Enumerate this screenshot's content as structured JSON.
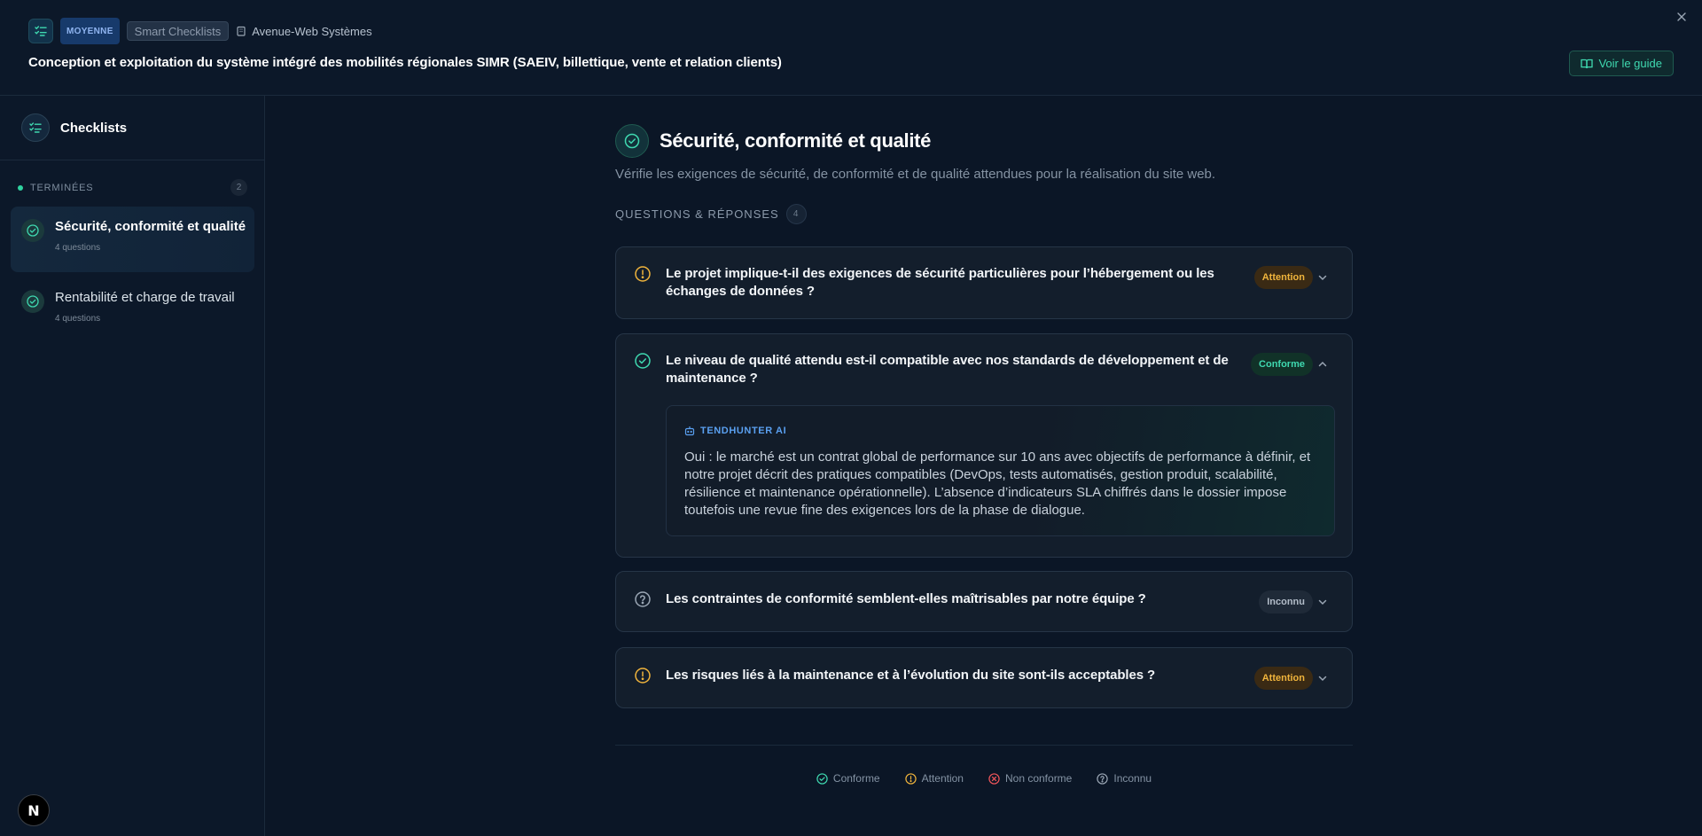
{
  "header": {
    "level_badge": "MOYENNE",
    "app_name": "Smart Checklists",
    "company": "Avenue-Web Systèmes",
    "title": "Conception et exploitation du système intégré des mobilités régionales SIMR (SAEIV, billettique, vente et relation clients)",
    "guide_button": "Voir le guide"
  },
  "sidebar": {
    "title": "Checklists",
    "section_label": "TERMINÉES",
    "section_count": "2",
    "items": [
      {
        "title": "Sécurité, conformité et qualité",
        "subtitle": "4 questions",
        "active": true
      },
      {
        "title": "Rentabilité et charge de travail",
        "subtitle": "4 questions",
        "active": false
      }
    ],
    "avatar_letter": "N"
  },
  "main": {
    "title": "Sécurité, conformité et qualité",
    "description": "Vérifie les exigences de sécurité, de conformité et de qualité attendues pour la réalisation du site web.",
    "qa_label": "QUESTIONS & RÉPONSES",
    "qa_count": "4",
    "questions": [
      {
        "text": "Le projet implique-t-il des exigences de sécurité particulières pour l’hébergement ou les échanges de données ?",
        "status": "Attention",
        "status_type": "attention",
        "expanded": false
      },
      {
        "text": "Le niveau de qualité attendu est-il compatible avec nos standards de développement et de maintenance ?",
        "status": "Conforme",
        "status_type": "conforme",
        "expanded": true,
        "ai_label": "TENDHUNTER AI",
        "ai_answer": "Oui : le marché est un contrat global de performance sur 10 ans avec objectifs de performance à définir, et notre projet décrit des pratiques compatibles (DevOps, tests automatisés, gestion produit, scalabilité, résilience et maintenance opérationnelle). L’absence d’indicateurs SLA chiffrés dans le dossier impose toutefois une revue fine des exigences lors de la phase de dialogue."
      },
      {
        "text": "Les contraintes de conformité semblent-elles maîtrisables par notre équipe ?",
        "status": "Inconnu",
        "status_type": "inconnu",
        "expanded": false
      },
      {
        "text": "Les risques liés à la maintenance et à l’évolution du site sont-ils acceptables ?",
        "status": "Attention",
        "status_type": "attention",
        "expanded": false
      }
    ],
    "legend": [
      {
        "label": "Conforme",
        "icon": "check-circle-icon",
        "color": "#3fd9b0"
      },
      {
        "label": "Attention",
        "icon": "alert-circle-icon",
        "color": "#f0b43c"
      },
      {
        "label": "Non conforme",
        "icon": "x-circle-icon",
        "color": "#f0555a"
      },
      {
        "label": "Inconnu",
        "icon": "help-circle-icon",
        "color": "#9aa6b4"
      }
    ]
  },
  "colors": {
    "background": "#0b1626",
    "accent": "#3fd9b0",
    "attention": "#f0b43c",
    "non_conforme": "#f0555a",
    "ai_label": "#5aa0f0"
  }
}
